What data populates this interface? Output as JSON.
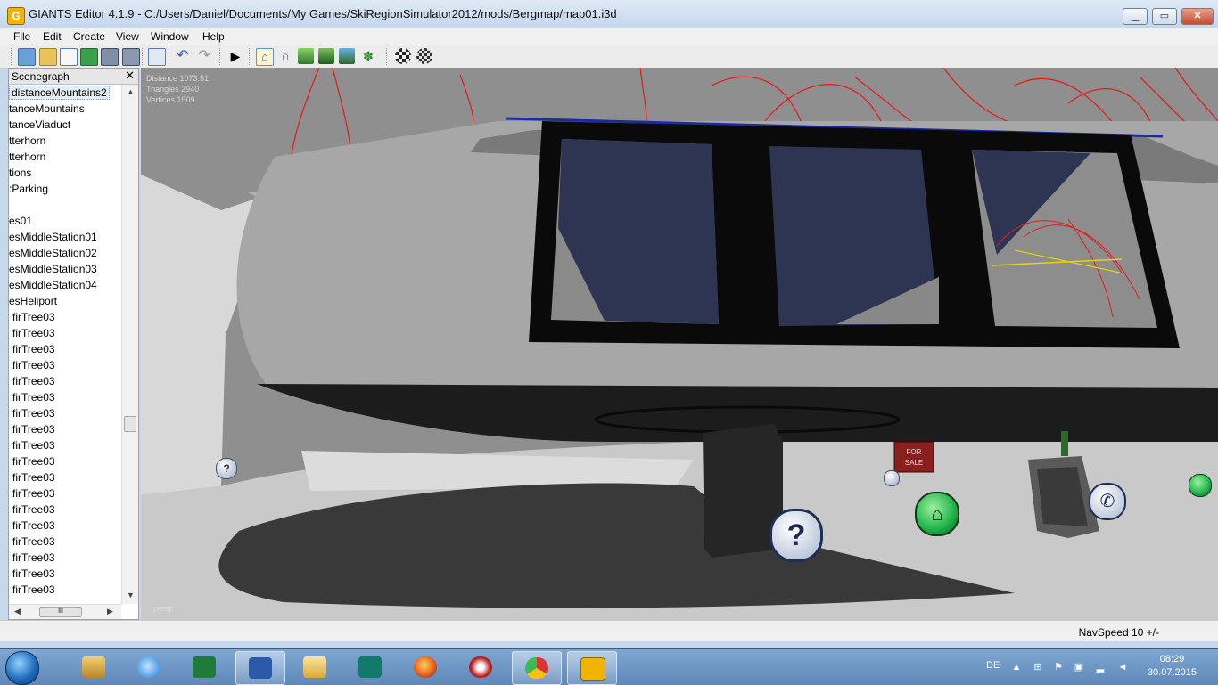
{
  "window": {
    "app_icon_letter": "G",
    "title": "GIANTS Editor 4.1.9 - C:/Users/Daniel/Documents/My Games/SkiRegionSimulator2012/mods/Bergmap/map01.i3d",
    "minimize": "▁",
    "maximize": "▭",
    "close": "✕"
  },
  "menu": [
    "File",
    "Edit",
    "Create",
    "View",
    "Window",
    "Help"
  ],
  "scenegraph": {
    "title": "Scenegraph",
    "close": "✕",
    "items": [
      "distanceMountains2",
      "tanceMountains",
      "tanceViaduct",
      "tterhorn",
      "tterhorn",
      "tions",
      ":Parking",
      "",
      "es01",
      "esMiddleStation01",
      "esMiddleStation02",
      "esMiddleStation03",
      "esMiddleStation04",
      "esHeliport",
      "firTree03",
      "firTree03",
      "firTree03",
      "firTree03",
      "firTree03",
      "firTree03",
      "firTree03",
      "firTree03",
      "firTree03",
      "firTree03",
      "firTree03",
      "firTree03",
      "firTree03",
      "firTree03",
      "firTree03",
      "firTree03",
      "firTree03",
      "firTree03"
    ],
    "hscroll_thumb": "III"
  },
  "viewport": {
    "stats": [
      "Distance 1073.51",
      "Triangles 2940",
      "Vertices 1509"
    ],
    "camera": "persp",
    "sign_text": [
      "FOR",
      "SALE"
    ],
    "question_mark": "?"
  },
  "status": {
    "navspeed": "NavSpeed 10 +/-"
  },
  "tray": {
    "lang": "DE",
    "time": "08:29",
    "date": "30.07.2015"
  },
  "colors": {
    "accent": "#f0b400",
    "red_splines": "#e02020",
    "blue_line": "#1a2aa0",
    "green_icon": "#1fb24a"
  }
}
